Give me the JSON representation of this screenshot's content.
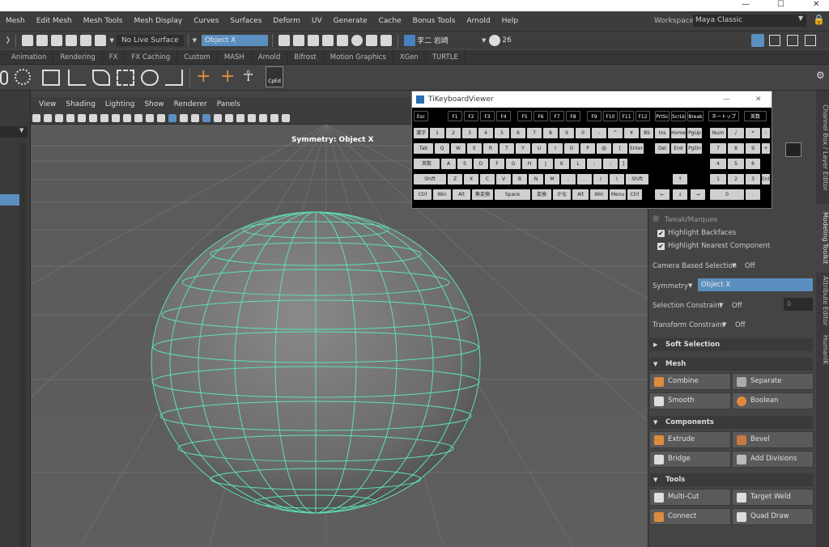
{
  "menubar": {
    "items": [
      "Mesh",
      "Edit Mesh",
      "Mesh Tools",
      "Mesh Display",
      "Curves",
      "Surfaces",
      "Deform",
      "UV",
      "Generate",
      "Cache",
      "Bonus Tools",
      "Arnold",
      "Help"
    ],
    "workspace_label": "Workspace:",
    "workspace_value": "Maya Classic"
  },
  "statusline": {
    "live_surface": "No Live Surface",
    "symmetry_field": "Object X",
    "user_name": "李二 岩崎",
    "count": "26"
  },
  "shelf_tabs": [
    "Animation",
    "Rendering",
    "FX",
    "FX Caching",
    "Custom",
    "MASH",
    "Arnold",
    "Bifrost",
    "Motion Graphics",
    "XGen",
    "TURTLE"
  ],
  "shelf": {
    "cped_label": "CpEd"
  },
  "viewport": {
    "menu": [
      "View",
      "Shading",
      "Lighting",
      "Show",
      "Renderer",
      "Panels"
    ],
    "symmetry_label": "Symmetry: Object X"
  },
  "keyboard_viewer": {
    "title": "TiKeyboardViewer",
    "row_f": [
      "Esc",
      "F1",
      "F2",
      "F3",
      "F4",
      "F5",
      "F6",
      "F7",
      "F8",
      "F9",
      "F10",
      "F11",
      "F12",
      "PrtSc",
      "ScrLk",
      "Break",
      "ネートップ",
      "英数"
    ],
    "row_num": [
      "漢字",
      "1",
      "2",
      "3",
      "4",
      "5",
      "6",
      "7",
      "8",
      "9",
      "0",
      "-",
      "^",
      "¥",
      "BS",
      "Ins",
      "Home",
      "PgUp",
      "Num",
      "/",
      "*",
      "-"
    ],
    "row_q": [
      "Tab",
      "Q",
      "W",
      "E",
      "R",
      "T",
      "Y",
      "U",
      "I",
      "O",
      "P",
      "@",
      "[",
      "Enter",
      "Del",
      "End",
      "PgDn",
      "7",
      "8",
      "9",
      "+"
    ],
    "row_a": [
      "英数",
      "A",
      "S",
      "D",
      "F",
      "G",
      "H",
      "J",
      "K",
      "L",
      ";",
      ":",
      "]",
      "4",
      "5",
      "6"
    ],
    "row_z": [
      "Shift",
      "Z",
      "X",
      "C",
      "V",
      "B",
      "N",
      "M",
      ",",
      ".",
      "/",
      "\\",
      "Shift",
      "↑",
      "1",
      "2",
      "3",
      "Enter"
    ],
    "row_ctrl": [
      "Ctrl",
      "Win",
      "Alt",
      "無変換",
      "Space",
      "変換",
      "かな",
      "Alt",
      "Win",
      "Menu",
      "Ctrl",
      "←",
      "↓",
      "→",
      "0",
      "."
    ]
  },
  "modeling_toolkit": {
    "tweak_marquee": "Tweak/Marquee",
    "highlight_backfaces": "Highlight Backfaces",
    "highlight_nearest": "Highlight Nearest Component",
    "camera_based_label": "Camera Based Selection",
    "camera_based_value": "Off",
    "symmetry_label": "Symmetry",
    "symmetry_value": "Object X",
    "selection_constraint_label": "Selection Constraint",
    "selection_constraint_value": "Off",
    "selection_constraint_num": "0",
    "transform_constraint_label": "Transform Constraint",
    "transform_constraint_value": "Off",
    "soft_selection": "Soft Selection",
    "mesh_section": "Mesh",
    "combine": "Combine",
    "separate": "Separate",
    "smooth": "Smooth",
    "boolean": "Boolean",
    "components_section": "Components",
    "extrude": "Extrude",
    "bevel": "Bevel",
    "bridge": "Bridge",
    "add_divisions": "Add Divisions",
    "tools_section": "Tools",
    "multi_cut": "Multi-Cut",
    "target_weld": "Target Weld",
    "connect": "Connect",
    "quad_draw": "Quad Draw"
  },
  "side_tabs": [
    "Channel Box / Layer Editor",
    "Modeling Toolkit",
    "Attribute Editor",
    "HumanIK"
  ],
  "colors": {
    "wire": "#5fe0b0",
    "accent_field": "#5b8fbf",
    "orange_icon": "#e08a3c"
  }
}
